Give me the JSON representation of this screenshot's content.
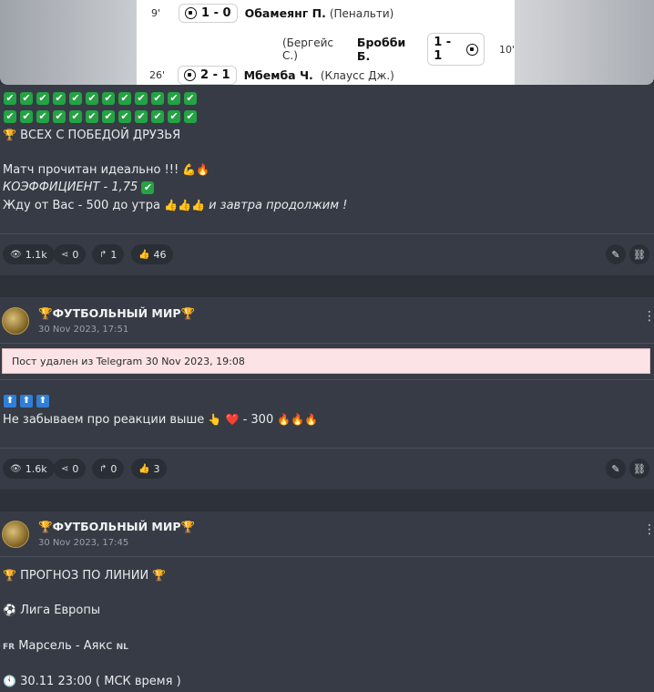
{
  "preview": {
    "events": [
      {
        "minute": "9'",
        "score": "1 - 0",
        "player": "Обамеянг П.",
        "note": "(Пенальти)"
      },
      {
        "minute": "10'",
        "score": "1 - 1",
        "player": "Бробби Б.",
        "note": "(Бергейс С.)"
      },
      {
        "minute": "26'",
        "score": "2 - 1",
        "player": "Мбемба Ч.",
        "note": "(Клаусс Дж.)"
      }
    ]
  },
  "post1": {
    "check_symbol": "✔",
    "line_trophy": "ВСЕХ С ПОБЕДОЙ ДРУЗЬЯ",
    "line_match": "Матч прочитан идеально !!!",
    "line_coef": "КОЭФФИЦИЕНТ - 1,75",
    "line_wait": "Жду от Вас - 500 до утра",
    "line_wait_italic": "и завтра продолжим !",
    "stats": {
      "views": "1.1k",
      "shares": "0",
      "forwards": "1",
      "likes": "46"
    }
  },
  "post2": {
    "channel": "ФУТБОЛЬНЫЙ МИР",
    "date": "30 Nov 2023, 17:51",
    "deleted_text": "Пост удален из Telegram",
    "deleted_date": "30 Nov 2023, 19:08",
    "arrow_symbol": "⬆",
    "line_reactions": "Не забываем про реакции выше",
    "line_reactions_tail": "- 300",
    "stats": {
      "views": "1.6k",
      "shares": "0",
      "forwards": "0",
      "likes": "3"
    }
  },
  "post3": {
    "channel": "ФУТБОЛЬНЫЙ МИР",
    "date": "30 Nov 2023, 17:45",
    "line_forecast": "ПРОГНОЗ ПО ЛИНИИ",
    "line_league": "Лига Европы",
    "flag_fr": "FR",
    "line_match": "Марсель - Аякс",
    "flag_nl": "NL",
    "line_time": "30.11 23:00 ( МСК время )"
  },
  "colors": {
    "background": "#363b45",
    "check_green": "#25a244",
    "deleted_bg": "#fce4e6"
  }
}
